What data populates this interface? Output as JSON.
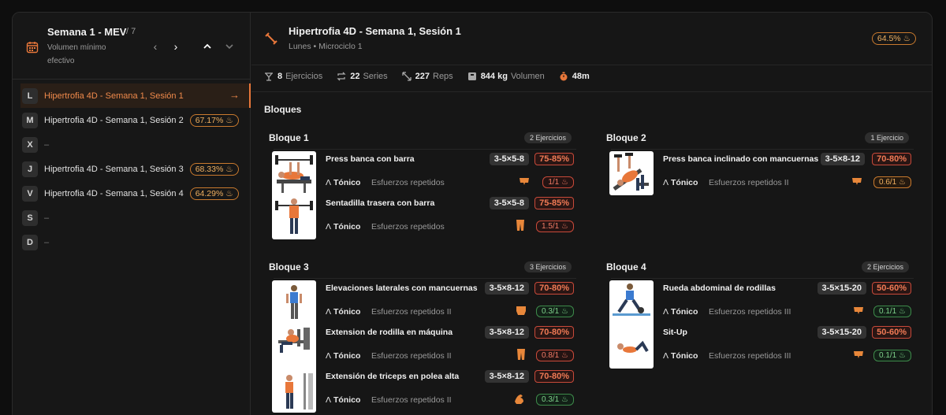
{
  "sidebar": {
    "title": "Semana 1 - MEV",
    "count": "/ 7",
    "subtitle": "Volumen mínimo efectivo",
    "days": [
      {
        "letter": "L",
        "name": "Hipertrofia 4D - Semana 1, Sesión 1",
        "pct": "",
        "active": true
      },
      {
        "letter": "M",
        "name": "Hipertrofia 4D - Semana 1, Sesión 2",
        "pct": "67.17%"
      },
      {
        "letter": "X",
        "name": "–",
        "pct": ""
      },
      {
        "letter": "J",
        "name": "Hipertrofia 4D - Semana 1, Sesión 3",
        "pct": "68.33%"
      },
      {
        "letter": "V",
        "name": "Hipertrofia 4D - Semana 1, Sesión 4",
        "pct": "64.29%"
      },
      {
        "letter": "S",
        "name": "–",
        "pct": ""
      },
      {
        "letter": "D",
        "name": "–",
        "pct": ""
      }
    ]
  },
  "header": {
    "title": "Hipertrofia 4D - Semana 1, Sesión 1",
    "subtitle": "Lunes • Microciclo 1",
    "pct": "64.5%"
  },
  "stats": {
    "exercises_value": "8",
    "exercises_label": "Ejercicios",
    "series_value": "22",
    "series_label": "Series",
    "reps_value": "227",
    "reps_label": "Reps",
    "volume_value": "844 kg",
    "volume_label": "Volumen",
    "time_value": "48m"
  },
  "section_title": "Bloques",
  "tonic_label": "Tónico",
  "blocks": [
    {
      "title": "Bloque 1",
      "count": "2 Ejercicios",
      "exercises": [
        {
          "name": "Press banca con barra",
          "scheme": "3-5×5-8",
          "intensity": "75-85%",
          "method": "Esfuerzos repetidos",
          "muscle_icon": "chest-icon",
          "rir": "1/1",
          "rir_color": "red"
        },
        {
          "name": "Sentadilla trasera con barra",
          "scheme": "3-5×5-8",
          "intensity": "75-85%",
          "method": "Esfuerzos repetidos",
          "muscle_icon": "legs-icon",
          "rir": "1.5/1",
          "rir_color": "red"
        }
      ]
    },
    {
      "title": "Bloque 2",
      "count": "1 Ejercicio",
      "exercises": [
        {
          "name": "Press banca inclinado con mancuernas",
          "scheme": "3-5×8-12",
          "intensity": "70-80%",
          "method": "Esfuerzos repetidos II",
          "muscle_icon": "chest-icon",
          "rir": "0.6/1",
          "rir_color": "orange"
        }
      ]
    },
    {
      "title": "Bloque 3",
      "count": "3 Ejercicios",
      "exercises": [
        {
          "name": "Elevaciones laterales con mancuernas",
          "scheme": "3-5×8-12",
          "intensity": "70-80%",
          "method": "Esfuerzos repetidos II",
          "muscle_icon": "shoulder-icon",
          "rir": "0.3/1",
          "rir_color": "green"
        },
        {
          "name": "Extension de rodilla en máquina",
          "scheme": "3-5×8-12",
          "intensity": "70-80%",
          "method": "Esfuerzos repetidos II",
          "muscle_icon": "legs-icon",
          "rir": "0.8/1",
          "rir_color": "red"
        },
        {
          "name": "Extensión de triceps en polea alta",
          "scheme": "3-5×8-12",
          "intensity": "70-80%",
          "method": "Esfuerzos repetidos II",
          "muscle_icon": "arm-icon",
          "rir": "0.3/1",
          "rir_color": "green"
        }
      ]
    },
    {
      "title": "Bloque 4",
      "count": "2 Ejercicios",
      "exercises": [
        {
          "name": "Rueda abdominal de rodillas",
          "scheme": "3-5×15-20",
          "intensity": "50-60%",
          "method": "Esfuerzos repetidos III",
          "muscle_icon": "chest-icon",
          "rir": "0.1/1",
          "rir_color": "green"
        },
        {
          "name": "Sit-Up",
          "scheme": "3-5×15-20",
          "intensity": "50-60%",
          "method": "Esfuerzos repetidos III",
          "muscle_icon": "chest-icon",
          "rir": "0.1/1",
          "rir_color": "green"
        }
      ]
    }
  ],
  "colors": {
    "accent": "#e8773a",
    "badge": "#f0b060",
    "intensity": "#f07a55",
    "background": "#161616"
  }
}
